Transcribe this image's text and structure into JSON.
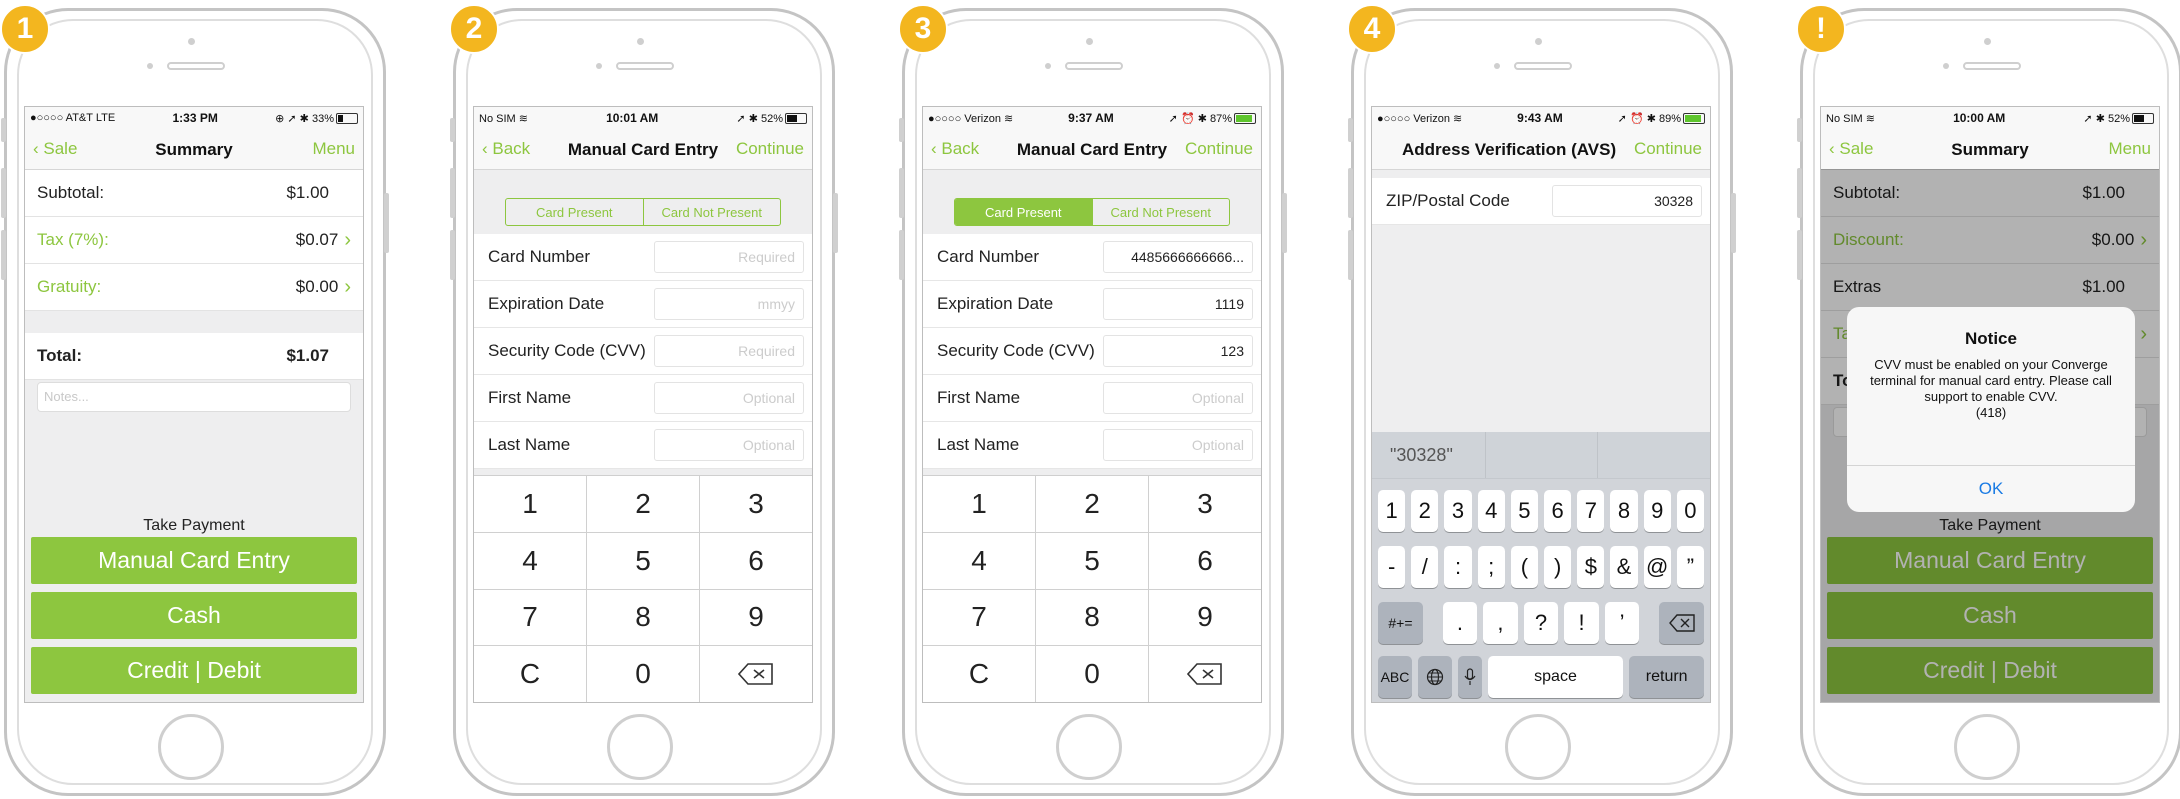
{
  "steps": [
    "1",
    "2",
    "3",
    "4",
    "!"
  ],
  "colors": {
    "accent": "#8dc63f",
    "badge": "#f3b61f",
    "link": "#1a7be4"
  },
  "p1": {
    "status": {
      "carrier": "●○○○○ AT&T  LTE",
      "time": "1:33 PM",
      "right": "⊕ ➚ ✱ 33%"
    },
    "nav": {
      "back": "Sale",
      "title": "Summary",
      "right": "Menu"
    },
    "rows": [
      {
        "label": "Subtotal:",
        "value": "$1.00"
      },
      {
        "label": "Tax (7%):",
        "value": "$0.07"
      },
      {
        "label": "Gratuity:",
        "value": "$0.00"
      }
    ],
    "total": {
      "label": "Total:",
      "value": "$1.07"
    },
    "notes_placeholder": "Notes...",
    "take_payment": "Take Payment",
    "buttons": [
      "Manual Card Entry",
      "Cash",
      "Credit | Debit"
    ]
  },
  "p2": {
    "status": {
      "carrier": "No SIM ≋",
      "time": "10:01 AM",
      "right": "➚ ✱ 52%"
    },
    "nav": {
      "back": "Back",
      "title": "Manual Card Entry",
      "right": "Continue"
    },
    "seg": [
      "Card Present",
      "Card Not Present"
    ],
    "fields": [
      {
        "label": "Card Number",
        "value": "Required"
      },
      {
        "label": "Expiration Date",
        "value": "mmyy"
      },
      {
        "label": "Security Code (CVV)",
        "value": "Required"
      },
      {
        "label": "First Name",
        "value": "Optional"
      },
      {
        "label": "Last Name",
        "value": "Optional"
      }
    ],
    "keys": [
      "1",
      "2",
      "3",
      "4",
      "5",
      "6",
      "7",
      "8",
      "9",
      "C",
      "0"
    ]
  },
  "p3": {
    "status": {
      "carrier": "●○○○○ Verizon ≋",
      "time": "9:37 AM",
      "right": "➚ ⏰ ✱ 87%"
    },
    "nav": {
      "back": "Back",
      "title": "Manual Card Entry",
      "right": "Continue"
    },
    "seg": [
      "Card Present",
      "Card Not Present"
    ],
    "fields": [
      {
        "label": "Card Number",
        "value": "4485666666666..."
      },
      {
        "label": "Expiration Date",
        "value": "1119"
      },
      {
        "label": "Security Code (CVV)",
        "value": "123"
      },
      {
        "label": "First Name",
        "value": "Optional"
      },
      {
        "label": "Last Name",
        "value": "Optional"
      }
    ],
    "keys": [
      "1",
      "2",
      "3",
      "4",
      "5",
      "6",
      "7",
      "8",
      "9",
      "C",
      "0"
    ]
  },
  "p4": {
    "status": {
      "carrier": "●○○○○ Verizon ≋",
      "time": "9:43 AM",
      "right": "➚ ⏰ ✱ 89%"
    },
    "nav": {
      "title": "Address Verification (AVS)",
      "right": "Continue"
    },
    "field": {
      "label": "ZIP/Postal Code",
      "value": "30328"
    },
    "suggestion": "\"30328\"",
    "row1": [
      "1",
      "2",
      "3",
      "4",
      "5",
      "6",
      "7",
      "8",
      "9",
      "0"
    ],
    "row2": [
      "-",
      "/",
      ":",
      ";",
      "(",
      ")",
      "$",
      "&",
      "@",
      "”"
    ],
    "row3": [
      ".",
      ",",
      "?",
      "!",
      "’"
    ],
    "row3_left": "#+=",
    "row4": {
      "abc": "ABC",
      "space": "space",
      "return": "return"
    }
  },
  "p5": {
    "status": {
      "carrier": "No SIM ≋",
      "time": "10:00 AM",
      "right": "➚ ✱ 52%"
    },
    "nav": {
      "back": "Sale",
      "title": "Summary",
      "right": "Menu"
    },
    "rows": [
      {
        "label": "Subtotal:",
        "value": "$1.00"
      },
      {
        "label": "Discount:",
        "value": "$0.00"
      },
      {
        "label": "Extras",
        "value": "$1.00"
      },
      {
        "label": "Ta",
        "value": ""
      },
      {
        "label": "To",
        "value": ""
      }
    ],
    "take_payment": "Take Payment",
    "buttons": [
      "Manual Card Entry",
      "Cash",
      "Credit | Debit"
    ],
    "alert": {
      "title": "Notice",
      "message": "CVV must be enabled on your Converge terminal for manual card entry. Please call support to enable CVV.",
      "code": "(418)",
      "ok": "OK"
    }
  }
}
